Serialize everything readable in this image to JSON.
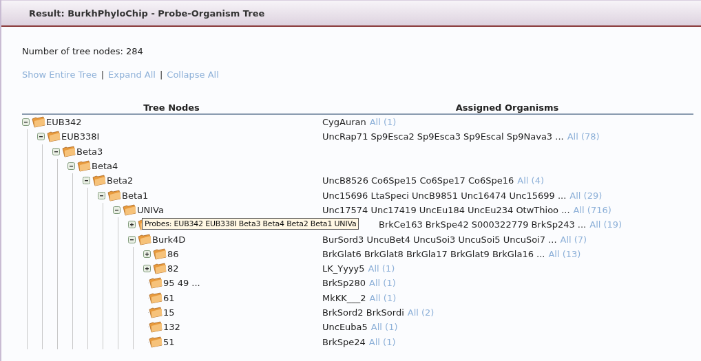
{
  "panel": {
    "title": "Result: BurkhPhyloChip - Probe-Organism Tree"
  },
  "node_count": "Number of tree nodes: 284",
  "actions": [
    "Show Entire Tree",
    "Expand All",
    "Collapse All"
  ],
  "separators": [
    "|",
    "|"
  ],
  "table": {
    "columns": [
      "Tree Nodes",
      "Assigned Organisms"
    ],
    "tree": [
      {
        "label": "EUB342",
        "expanded": true,
        "organisms": "CygAuran",
        "link": "All (1)",
        "children": [
          {
            "label": "EUB338I",
            "expanded": true,
            "organisms": "UncRap71 Sp9Esca2 Sp9Esca3 Sp9Escal Sp9Nava3 ...",
            "link": "All (78)",
            "children": [
              {
                "label": "Beta3",
                "expanded": true,
                "children": [
                  {
                    "label": "Beta4",
                    "expanded": true,
                    "children": [
                      {
                        "label": "Beta2",
                        "expanded": true,
                        "organisms": "UncB8526 Co6Spe15 Co6Spe17 Co6Spe16",
                        "link": "All (4)",
                        "children": [
                          {
                            "label": "Beta1",
                            "expanded": true,
                            "organisms": "Unc15696 LtaSpeci UncB9851 Unc16474 Unc15699 ...",
                            "link": "All (29)",
                            "children": [
                              {
                                "label": "UNIVa",
                                "expanded": true,
                                "organisms": "Unc17574 Unc17419 UncEu184 UncEu234 OtwThioo ...",
                                "link": "All (716)",
                                "children": [
                                  {
                                    "expanded": false,
                                    "organisms": "BrkCe163 BrkSpe42 S000322779 BrkSp243 ...",
                                    "link": "All (19)"
                                  },
                                  {
                                    "label": "Burk4D",
                                    "expanded": true,
                                    "organisms": "BurSord3 UncuBet4 UncuSoi3 UncuSoi5 UncuSoi7 ...",
                                    "link": "All (7)",
                                    "children": [
                                      {
                                        "label": "86",
                                        "expanded": false,
                                        "organisms": "BrkGlat6 BrkGlat8 BrkGla17 BrkGlat9 BrkGla16 ...",
                                        "link": "All (13)"
                                      },
                                      {
                                        "label": "82",
                                        "expanded": false,
                                        "organisms": "LK_Yyyy5",
                                        "link": "All (1)"
                                      },
                                      {
                                        "label": "95 49 ...",
                                        "organisms": "BrkSp280",
                                        "link": "All (1)"
                                      },
                                      {
                                        "label": "61",
                                        "organisms": "MkKK___2",
                                        "link": "All (1)"
                                      },
                                      {
                                        "label": "15",
                                        "organisms": "BrkSord2 BrkSordi",
                                        "link": "All (2)"
                                      },
                                      {
                                        "label": "132",
                                        "organisms": "UncEuba5",
                                        "link": "All (1)"
                                      },
                                      {
                                        "label": "51",
                                        "organisms": "BrkSpe24",
                                        "link": "All (1)"
                                      }
                                    ]
                                  }
                                ]
                              }
                            ]
                          }
                        ]
                      }
                    ]
                  }
                ]
              }
            ]
          }
        ]
      }
    ]
  },
  "tooltip": "Probes: EUB342 EUB338I Beta3 Beta4 Beta2 Beta1 UNIVa"
}
